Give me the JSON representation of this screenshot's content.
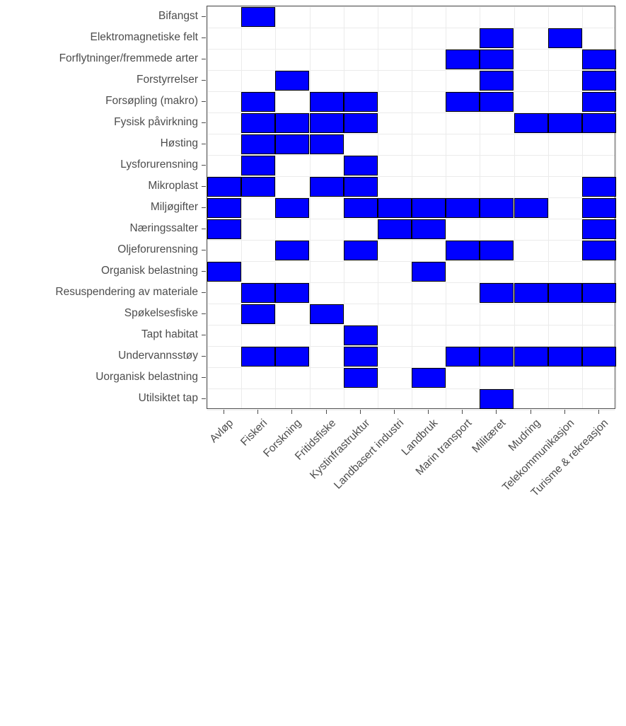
{
  "chart_data": {
    "type": "heatmap",
    "title": "",
    "subtitle": "",
    "xlabel": "",
    "ylabel": "",
    "grid": true,
    "legend": "none",
    "value_scale": {
      "present_color": "#0000ff",
      "absent_color": "#ffffff",
      "present_value": 1,
      "absent_value": 0
    },
    "categories": [
      "Avløp",
      "Fiskeri",
      "Forskning",
      "Fritidsfiske",
      "Kystinfrastruktur",
      "Landbasert industri",
      "Landbruk",
      "Marin transport",
      "Militæret",
      "Mudring",
      "Telekommunikasjon",
      "Turisme & rekreasjon"
    ],
    "rows": [
      "Bifangst",
      "Elektromagnetiske felt",
      "Forflytninger/fremmede arter",
      "Forstyrrelser",
      "Forsøpling (makro)",
      "Fysisk påvirkning",
      "Høsting",
      "Lysforurensning",
      "Mikroplast",
      "Miljøgifter",
      "Næringssalter",
      "Oljeforurensning",
      "Organisk belastning",
      "Resuspendering av materiale",
      "Spøkelsesfiske",
      "Tapt habitat",
      "Undervannsstøy",
      "Uorganisk belastning",
      "Utilsiktet tap"
    ],
    "matrix": [
      [
        0,
        1,
        0,
        0,
        0,
        0,
        0,
        0,
        0,
        0,
        0,
        0
      ],
      [
        0,
        0,
        0,
        0,
        0,
        0,
        0,
        0,
        1,
        0,
        1,
        0
      ],
      [
        0,
        0,
        0,
        0,
        0,
        0,
        0,
        1,
        1,
        0,
        0,
        1
      ],
      [
        0,
        0,
        1,
        0,
        0,
        0,
        0,
        0,
        1,
        0,
        0,
        1
      ],
      [
        0,
        1,
        0,
        1,
        1,
        0,
        0,
        1,
        1,
        0,
        0,
        1
      ],
      [
        0,
        1,
        1,
        1,
        1,
        0,
        0,
        0,
        0,
        1,
        1,
        1
      ],
      [
        0,
        1,
        1,
        1,
        0,
        0,
        0,
        0,
        0,
        0,
        0,
        0
      ],
      [
        0,
        1,
        0,
        0,
        1,
        0,
        0,
        0,
        0,
        0,
        0,
        0
      ],
      [
        1,
        1,
        0,
        1,
        1,
        0,
        0,
        0,
        0,
        0,
        0,
        1
      ],
      [
        1,
        0,
        1,
        0,
        1,
        1,
        1,
        1,
        1,
        1,
        0,
        1
      ],
      [
        1,
        0,
        0,
        0,
        0,
        1,
        1,
        0,
        0,
        0,
        0,
        1
      ],
      [
        0,
        0,
        1,
        0,
        1,
        0,
        0,
        1,
        1,
        0,
        0,
        1
      ],
      [
        1,
        0,
        0,
        0,
        0,
        0,
        1,
        0,
        0,
        0,
        0,
        0
      ],
      [
        0,
        1,
        1,
        0,
        0,
        0,
        0,
        0,
        1,
        1,
        1,
        1
      ],
      [
        0,
        1,
        0,
        1,
        0,
        0,
        0,
        0,
        0,
        0,
        0,
        0
      ],
      [
        0,
        0,
        0,
        0,
        1,
        0,
        0,
        0,
        0,
        0,
        0,
        0
      ],
      [
        0,
        1,
        1,
        0,
        1,
        0,
        0,
        1,
        1,
        1,
        1,
        1
      ],
      [
        0,
        0,
        0,
        0,
        1,
        0,
        1,
        0,
        0,
        0,
        0,
        0
      ],
      [
        0,
        0,
        0,
        0,
        0,
        0,
        0,
        0,
        1,
        0,
        0,
        0
      ]
    ]
  },
  "axes": {
    "y_labels": [
      "Bifangst",
      "Elektromagnetiske felt",
      "Forflytninger/fremmede arter",
      "Forstyrrelser",
      "Forsøpling (makro)",
      "Fysisk påvirkning",
      "Høsting",
      "Lysforurensning",
      "Mikroplast",
      "Miljøgifter",
      "Næringssalter",
      "Oljeforurensning",
      "Organisk belastning",
      "Resuspendering av materiale",
      "Spøkelsesfiske",
      "Tapt habitat",
      "Undervannsstøy",
      "Uorganisk belastning",
      "Utilsiktet tap"
    ],
    "x_labels": [
      "Avløp",
      "Fiskeri",
      "Forskning",
      "Fritidsfiske",
      "Kystinfrastruktur",
      "Landbasert industri",
      "Landbruk",
      "Marin transport",
      "Militæret",
      "Mudring",
      "Telekommunikasjon",
      "Turisme & rekreasjon"
    ]
  },
  "style": {
    "cell_fill": "#0000ff",
    "cell_stroke": "#000000",
    "panel_background": "#ffffff",
    "gridline_color": "#ebebeb",
    "axis_text_color": "#4d4d4d",
    "panel_border_color": "#4d4d4d"
  }
}
